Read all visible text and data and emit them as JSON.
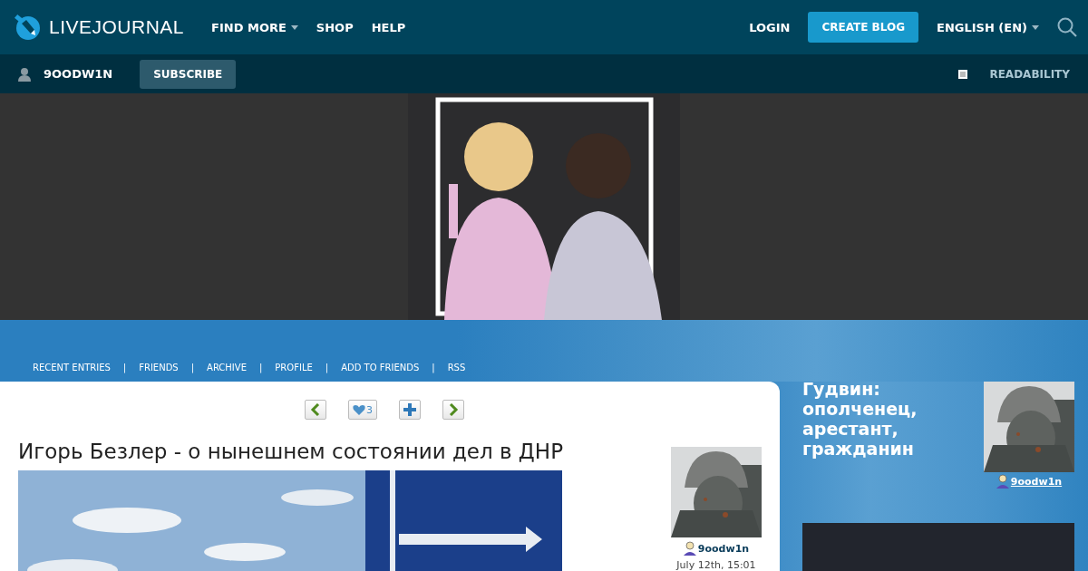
{
  "header": {
    "logo": "LIVEJOURNAL",
    "nav": [
      {
        "label": "FIND MORE",
        "dropdown": true
      },
      {
        "label": "SHOP",
        "dropdown": false
      },
      {
        "label": "HELP",
        "dropdown": false
      }
    ],
    "login": "LOGIN",
    "create_blog": "CREATE BLOG",
    "language": "ENGLISH (EN)"
  },
  "subheader": {
    "username": "9OODW1N",
    "subscribe": "SUBSCRIBE",
    "readability": {
      "label": "READABILITY",
      "checked": false
    }
  },
  "blog_nav": {
    "links": [
      "RECENT ENTRIES",
      "FRIENDS",
      "ARCHIVE",
      "PROFILE",
      "ADD TO FRIENDS",
      "RSS"
    ],
    "separators": [
      "|",
      "|",
      "|",
      "|",
      "|"
    ]
  },
  "entry": {
    "toolbar": [
      {
        "kind": "prev"
      },
      {
        "kind": "like",
        "count": "3"
      },
      {
        "kind": "add"
      },
      {
        "kind": "next"
      }
    ],
    "title": "Игорь Безлер - о нынешнем состоянии дел в ДНР",
    "author": "9oodw1n",
    "date": "July 12th, 15:01"
  },
  "sidebar": {
    "title": "Гудвин: ополченец, арестант, гражданин",
    "author": "9oodw1n"
  }
}
